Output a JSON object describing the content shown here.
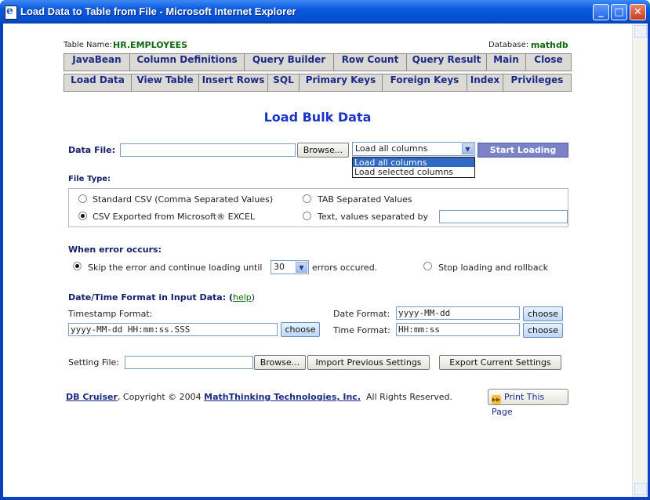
{
  "window": {
    "title": "Load Data to Table from File - Microsoft Internet Explorer",
    "minimize": "_",
    "maximize": "□",
    "close": "✕"
  },
  "header": {
    "table_label": "Table Name:",
    "table_value": "HR.EMPLOYEES",
    "db_label": "Database:",
    "db_value": "mathdb"
  },
  "nav_row1": [
    "JavaBean",
    "Column Definitions",
    "Query Builder",
    "Row Count",
    "Query Result",
    "Main",
    "Close"
  ],
  "nav_row2": [
    "Load Data",
    "View Table",
    "Insert Rows",
    "SQL",
    "Primary Keys",
    "Foreign Keys",
    "Index",
    "Privileges"
  ],
  "page_title": "Load Bulk Data",
  "data_file": {
    "label": "Data File:",
    "value": "",
    "browse": "Browse...",
    "columns_select": "Load all columns",
    "columns_options": [
      "Load all columns",
      "Load selected columns"
    ],
    "start": "Start Loading"
  },
  "file_type": {
    "label": "File Type:",
    "options": [
      "Standard CSV (Comma Separated Values)",
      "TAB Separated Values",
      "CSV Exported from Microsoft® EXCEL",
      "Text, values separated by"
    ],
    "selected": "CSV Exported from Microsoft® EXCEL",
    "separator_value": ""
  },
  "error": {
    "label": "When error occurs:",
    "skip_text": "Skip the error and continue loading until",
    "count": "30",
    "suffix": "errors occured.",
    "stop_text": "Stop loading and rollback"
  },
  "datetime": {
    "label": "Date/Time Format in Input Data: (",
    "help": "help",
    "close_paren": ")",
    "timestamp_label": "Timestamp Format:",
    "timestamp_value": "yyyy-MM-dd HH:mm:ss.SSS",
    "date_label": "Date Format:",
    "date_value": "yyyy-MM-dd",
    "time_label": "Time Format:",
    "time_value": "HH:mm:ss",
    "choose": "choose"
  },
  "settings": {
    "label": "Setting File:",
    "value": "",
    "browse": "Browse...",
    "import": "Import Previous Settings",
    "export": "Export Current Settings"
  },
  "footer": {
    "product": "DB Cruiser",
    "copyright": ",  Copyright © 2004 ",
    "company": "MathThinking Technologies, Inc.",
    "rights": "All Rights Reserved.",
    "print": "Print This Page"
  }
}
